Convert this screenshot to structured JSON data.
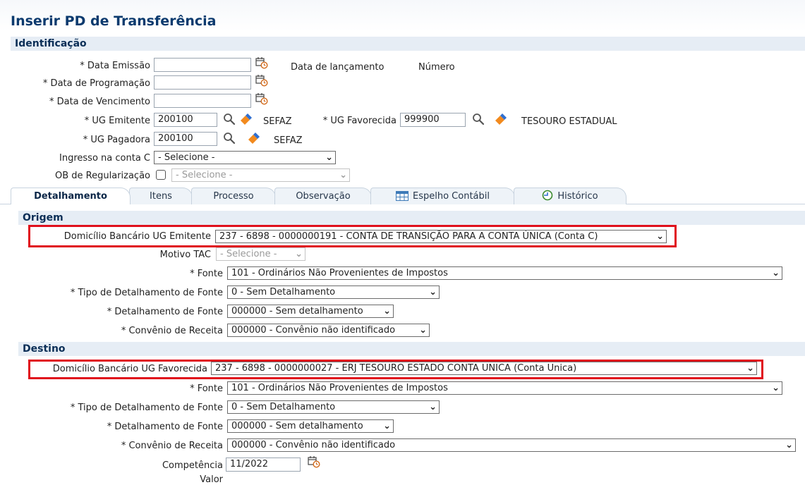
{
  "page_title": "Inserir PD de Transferência",
  "identificacao": {
    "section_title": "Identificação",
    "data_emissao_label": "* Data Emissão",
    "data_emissao_value": "",
    "data_programacao_label": "* Data de Programação",
    "data_programacao_value": "",
    "data_vencimento_label": "* Data de Vencimento",
    "data_vencimento_value": "",
    "data_lancamento_label": "Data de lançamento",
    "numero_label": "Número",
    "ug_emitente_label": "* UG Emitente",
    "ug_emitente_value": "200100",
    "ug_emitente_name": "SEFAZ",
    "ug_favorecida_label": "* UG Favorecida",
    "ug_favorecida_value": "999900",
    "ug_favorecida_name": "TESOURO ESTADUAL",
    "ug_pagadora_label": "* UG Pagadora",
    "ug_pagadora_value": "200100",
    "ug_pagadora_name": "SEFAZ",
    "ingresso_label": "Ingresso na conta C",
    "ingresso_value": "- Selecione -",
    "ob_regularizacao_label": "OB de Regularização",
    "ob_regularizacao_value": "- Selecione -"
  },
  "tabs": [
    {
      "label": "Detalhamento",
      "active": true
    },
    {
      "label": "Itens"
    },
    {
      "label": "Processo"
    },
    {
      "label": "Observação"
    },
    {
      "label": "Espelho Contábil",
      "icon": "table-icon"
    },
    {
      "label": "Histórico",
      "icon": "history-icon"
    }
  ],
  "origem": {
    "section_title": "Origem",
    "domicilio_label": "Domicílio Bancário UG Emitente",
    "domicilio_value": "237 - 6898 - 0000000191 - CONTA DE TRANSIÇÃO PARA A CONTA ÚNICA (Conta C)",
    "motivo_tac_label": "Motivo TAC",
    "motivo_tac_value": "- Selecione -",
    "fonte_label": "* Fonte",
    "fonte_value": "101 - Ordinários Não Provenientes de Impostos",
    "tipo_det_fonte_label": "* Tipo de Detalhamento de Fonte",
    "tipo_det_fonte_value": "0 - Sem Detalhamento",
    "det_fonte_label": "* Detalhamento de Fonte",
    "det_fonte_value": "000000 - Sem detalhamento",
    "convenio_label": "* Convênio de Receita",
    "convenio_value": "000000 - Convênio não identificado"
  },
  "destino": {
    "section_title": "Destino",
    "domicilio_label": "Domicílio Bancário UG Favorecida",
    "domicilio_value": "237 - 6898 - 0000000027 - ERJ TESOURO ESTADO CONTA UNICA (Conta Unica)",
    "fonte_label": "* Fonte",
    "fonte_value": "101 - Ordinários Não Provenientes de Impostos",
    "tipo_det_fonte_label": "* Tipo de Detalhamento de Fonte",
    "tipo_det_fonte_value": "0 - Sem Detalhamento",
    "det_fonte_label": "* Detalhamento de Fonte",
    "det_fonte_value": "000000 - Sem detalhamento",
    "convenio_label": "* Convênio de Receita",
    "convenio_value": "000000 - Convênio não identificado",
    "competencia_label": "Competência",
    "competencia_value": "11/2022",
    "valor_label": "Valor"
  },
  "colors": {
    "title": "#0b3a6e",
    "section_bg": "#e6edf5",
    "highlight_box": "#e0101c",
    "eraser_orange": "#f28a1e",
    "eraser_blue": "#2f6fd0"
  }
}
